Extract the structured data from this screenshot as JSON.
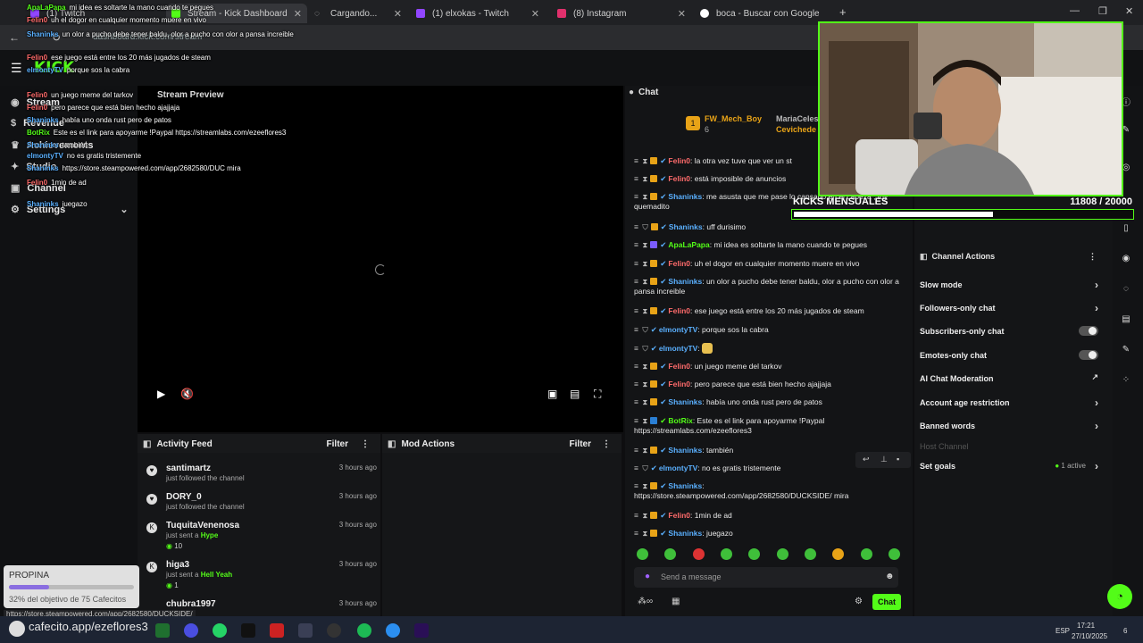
{
  "tabs": [
    {
      "label": "(1) Twitch",
      "color": "#9146ff"
    },
    {
      "label": "Stream - Kick Dashboard",
      "color": "#53fc18"
    },
    {
      "label": "Cargando...",
      "color": "#888888"
    },
    {
      "label": "(1) elxokas - Twitch",
      "color": "#9146ff"
    },
    {
      "label": "(8) Instagram",
      "color": "#e1306c"
    },
    {
      "label": "boca - Buscar con Google",
      "color": "#ffffff"
    }
  ],
  "address": {
    "url": "dashboard.kick.com/stream"
  },
  "logo": {
    "text": "KICK",
    "beta": "beta"
  },
  "sidebar": {
    "items": [
      {
        "label": "Stream"
      },
      {
        "label": "Revenue"
      },
      {
        "label": "Achievements"
      },
      {
        "label": "Studio"
      },
      {
        "label": "Channel"
      },
      {
        "label": "Settings"
      }
    ]
  },
  "preview": {
    "title": "Stream Preview"
  },
  "activity": {
    "title": "Activity Feed",
    "filter": "Filter",
    "items": [
      {
        "name": "santimartz",
        "sub": "just followed the channel",
        "time": "3 hours ago",
        "extra": ""
      },
      {
        "name": "DORY_0",
        "sub": "just followed the channel",
        "time": "3 hours ago",
        "extra": ""
      },
      {
        "name": "TuquitaVenenosa",
        "sub": "just sent a",
        "highlight": "Hype",
        "time": "3 hours ago",
        "extra": "10"
      },
      {
        "name": "higa3",
        "sub": "just sent a",
        "highlight": "Hell Yeah",
        "time": "3 hours ago",
        "extra": "1"
      },
      {
        "name": "chubra1997",
        "sub": "",
        "time": "3 hours ago",
        "extra": ""
      }
    ]
  },
  "mod_actions": {
    "title": "Mod Actions",
    "filter": "Filter"
  },
  "chat": {
    "title": "Chat",
    "pinned": {
      "name1": "FW_Mech_Boy",
      "count1": "6",
      "name2": "MariaCeleste",
      "name3": "Cevichede"
    },
    "messages": [
      {
        "user": "Felin0",
        "color": "#ff6b6b",
        "text": "la otra vez tuve que ver un st"
      },
      {
        "user": "Felin0",
        "color": "#ff6b6b",
        "text": "está imposible de anuncios"
      },
      {
        "user": "Shaninks",
        "color": "#5ab0ff",
        "text": "me asusta que me pase lo cansado en el cabeza , toy quemadito"
      },
      {
        "user": "Shaninks",
        "color": "#5ab0ff",
        "text": "uff durisimo"
      },
      {
        "user": "ApaLaPapa",
        "color": "#53fc18",
        "text": "mi idea es soltarte la mano cuando te pegues"
      },
      {
        "user": "Felin0",
        "color": "#ff6b6b",
        "text": "uh el dogor en cualquier momento muere en vivo"
      },
      {
        "user": "Shaninks",
        "color": "#5ab0ff",
        "text": "un olor a pucho debe tener baldu, olor a pucho con olor a pansa increible"
      },
      {
        "user": "Felin0",
        "color": "#ff6b6b",
        "text": "ese juego está entre los 20 más jugados de steam"
      },
      {
        "user": "elmontyTV",
        "color": "#5ab0ff",
        "text": "porque sos la cabra"
      },
      {
        "user": "elmontyTV",
        "color": "#5ab0ff",
        "text": ""
      },
      {
        "user": "Felin0",
        "color": "#ff6b6b",
        "text": "un juego meme del tarkov"
      },
      {
        "user": "Felin0",
        "color": "#ff6b6b",
        "text": "pero parece que está bien hecho ajajjaja"
      },
      {
        "user": "Shaninks",
        "color": "#5ab0ff",
        "text": "había uno onda rust pero de patos"
      },
      {
        "user": "BotRix",
        "color": "#53fc18",
        "text": "Este es el link para apoyarme !Paypal https://streamlabs.com/ezeeflores3"
      },
      {
        "user": "Shaninks",
        "color": "#5ab0ff",
        "text": "también"
      },
      {
        "user": "elmontyTV",
        "color": "#5ab0ff",
        "text": "no es gratis tristemente"
      },
      {
        "user": "Shaninks",
        "color": "#5ab0ff",
        "text": "https://store.steampowered.com/app/2682580/DUCKSIDE/ mira"
      },
      {
        "user": "Felin0",
        "color": "#ff6b6b",
        "text": "1min de ad"
      },
      {
        "user": "Shaninks",
        "color": "#5ab0ff",
        "text": "juegazo"
      }
    ],
    "input_placeholder": "Send a message",
    "send_label": "Chat"
  },
  "channel_actions": {
    "title": "Channel Actions",
    "items": [
      {
        "label": "Slow mode",
        "kind": "chevron"
      },
      {
        "label": "Followers-only chat",
        "kind": "chevron"
      },
      {
        "label": "Subscribers-only chat",
        "kind": "toggle"
      },
      {
        "label": "Emotes-only chat",
        "kind": "toggle"
      },
      {
        "label": "AI Chat Moderation",
        "kind": "external"
      },
      {
        "label": "Account age restriction",
        "kind": "chevron"
      },
      {
        "label": "Banned words",
        "kind": "chevron"
      },
      {
        "label": "Host Channel",
        "kind": "disabled"
      },
      {
        "label": "Set goals",
        "kind": "chevron",
        "badge": "1 active"
      }
    ]
  },
  "goal": {
    "title": "KICKS MENSUALES",
    "current": "11808",
    "target": "20000",
    "progress": 0.59
  },
  "overlay_chat": [
    {
      "user": "ApaLaPapa",
      "color": "#53fc18",
      "text": "mi idea es soltarte la mano cuando te pegues"
    },
    {
      "user": "Felin0",
      "color": "#ff6b6b",
      "text": "uh el dogor en cualquier momento muere en vivo"
    },
    {
      "user": "Shaninks",
      "color": "#5ab0ff",
      "text": "un olor a pucho debe tener baldu, olor a pucho con olor a pansa increible"
    },
    {
      "user": "Felin0",
      "color": "#ff6b6b",
      "text": "ese juego está entre los 20 más jugados de steam"
    },
    {
      "user": "elmontyTV",
      "color": "#5ab0ff",
      "text": "porque sos la cabra"
    },
    {
      "user": "Felin0",
      "color": "#ff6b6b",
      "text": "un juego meme del tarkov"
    },
    {
      "user": "Felin0",
      "color": "#ff6b6b",
      "text": "pero parece que está bien hecho ajajjaja"
    },
    {
      "user": "Shaninks",
      "color": "#5ab0ff",
      "text": "había uno onda rust pero de patos"
    },
    {
      "user": "BotRix",
      "color": "#53fc18",
      "text": "Este es el link para apoyarme !Paypal https://streamlabs.com/ezeeflores3"
    },
    {
      "user": "Shaninks",
      "color": "#5ab0ff",
      "text": "también"
    },
    {
      "user": "elmontyTV",
      "color": "#5ab0ff",
      "text": "no es gratis tristemente"
    },
    {
      "user": "Shaninks",
      "color": "#5ab0ff",
      "text": "https://store.steampowered.com/app/2682580/DUC mira"
    },
    {
      "user": "Felin0",
      "color": "#ff6b6b",
      "text": "1min de ad"
    },
    {
      "user": "Shaninks",
      "color": "#5ab0ff",
      "text": "juegazo"
    }
  ],
  "propina": {
    "title": "PROPINA",
    "subtitle": "32% del objetivo de 75 Cafecitos",
    "progress": 0.32
  },
  "status_url": "https://store.steampowered.com/app/2682580/DUCKSIDE/",
  "cafecito": "cafecito.app/ezeflores3",
  "taskbar": {
    "lang": "ESP",
    "time": "17:21",
    "date": "27/10/2025",
    "notif": "6"
  },
  "colors": {
    "kick_green": "#53fc18",
    "bg": "#0e0e10",
    "panel": "#151618"
  }
}
